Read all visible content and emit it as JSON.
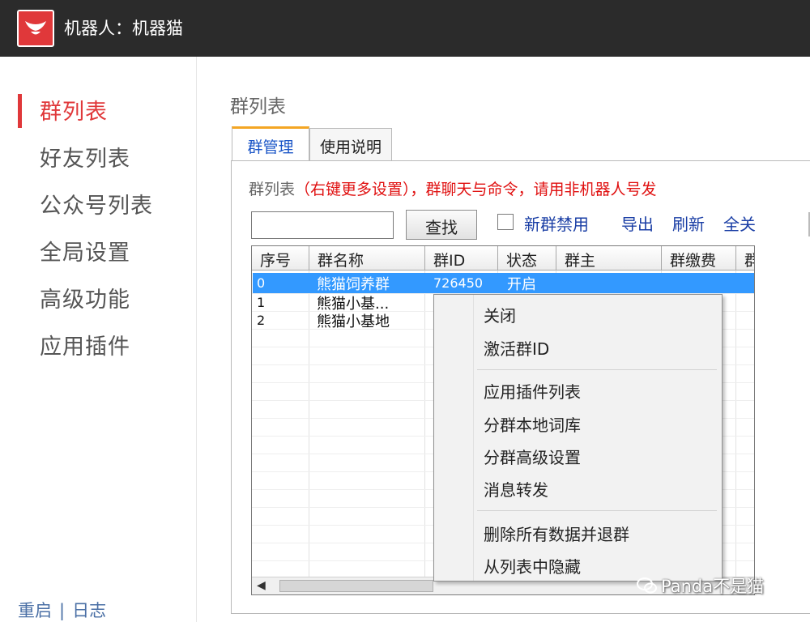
{
  "window": {
    "title": "机器人：机器猫"
  },
  "sidebar": {
    "items": [
      {
        "label": "群列表"
      },
      {
        "label": "好友列表"
      },
      {
        "label": "公众号列表"
      },
      {
        "label": "全局设置"
      },
      {
        "label": "高级功能"
      },
      {
        "label": "应用插件"
      }
    ],
    "footer": {
      "restart": "重启",
      "separator": "|",
      "log": "日志"
    }
  },
  "main": {
    "section_title": "群列表",
    "tabs": [
      {
        "label": "群管理"
      },
      {
        "label": "使用说明"
      }
    ],
    "panel_header": {
      "prefix": "群列表",
      "notice": "（右键更多设置），群聊天与命令，请用非机器人号发"
    },
    "toolbar": {
      "search_value": "",
      "search_button": "查找",
      "new_group_disable_label": "新群禁用",
      "export_link": "导出",
      "refresh_link": "刷新",
      "close_all_link": "全关"
    },
    "table": {
      "columns": [
        "序号",
        "群名称",
        "群ID",
        "状态",
        "群主",
        "群缴费",
        "群"
      ],
      "rows": [
        {
          "index": "0",
          "name": "熊猫饲养群",
          "id": "726450",
          "status": "开启"
        },
        {
          "index": "1",
          "name": "熊猫小基...",
          "id": "",
          "status": ""
        },
        {
          "index": "2",
          "name": "熊猫小基地",
          "id": "",
          "status": ""
        }
      ]
    }
  },
  "context_menu": {
    "items": [
      "关闭",
      "激活群ID",
      "应用插件列表",
      "分群本地词库",
      "分群高级设置",
      "消息转发",
      "删除所有数据并退群",
      "从列表中隐藏"
    ]
  },
  "watermark": {
    "text": "Panda不是猫"
  }
}
